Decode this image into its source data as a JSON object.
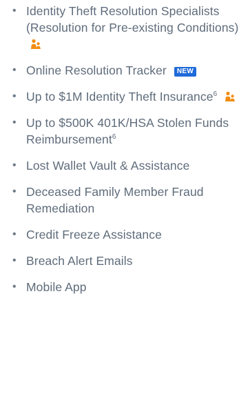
{
  "features": [
    {
      "text": "Identity Theft Resolution Specialists (Resolution for Pre-existing Conditions)",
      "icon": "family-icon"
    },
    {
      "text": "Online Resolution Tracker",
      "badge": "NEW"
    },
    {
      "text": "Up to $1M Identity Theft Insurance",
      "sup": "6",
      "icon": "family-icon"
    },
    {
      "text": "Up to $500K 401K/HSA Stolen Funds Reimbursement",
      "sup": "6"
    },
    {
      "text": "Lost Wallet Vault & Assistance"
    },
    {
      "text": "Deceased Family Member Fraud Remediation"
    },
    {
      "text": "Credit Freeze Assistance"
    },
    {
      "text": "Breach Alert Emails"
    },
    {
      "text": "Mobile App"
    }
  ],
  "colors": {
    "text": "#5f6c7b",
    "family_icon": "#f28c0f",
    "badge_bg": "#1f6ad9"
  }
}
